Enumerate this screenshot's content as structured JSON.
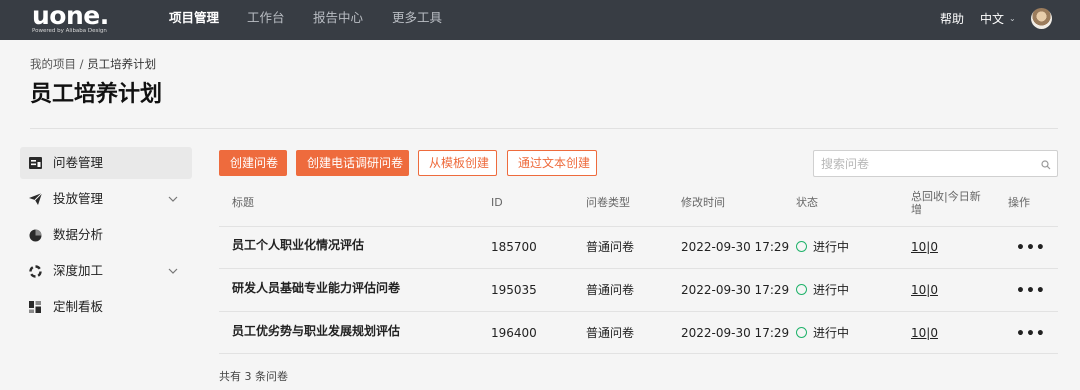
{
  "topbar": {
    "logo_text": "uone.",
    "logo_sub": "Powered by Alibaba Design",
    "nav": [
      "项目管理",
      "工作台",
      "报告中心",
      "更多工具"
    ],
    "help": "帮助",
    "language": "中文"
  },
  "breadcrumb": {
    "root": "我的项目",
    "separator": " / ",
    "current": "员工培养计划"
  },
  "page_title": "员工培养计划",
  "sidebar": {
    "items": [
      {
        "label": "问卷管理",
        "icon": "survey-icon",
        "active": true,
        "has_chevron": false
      },
      {
        "label": "投放管理",
        "icon": "send-icon",
        "active": false,
        "has_chevron": true
      },
      {
        "label": "数据分析",
        "icon": "pie-chart-icon",
        "active": false,
        "has_chevron": false
      },
      {
        "label": "深度加工",
        "icon": "process-icon",
        "active": false,
        "has_chevron": true
      },
      {
        "label": "定制看板",
        "icon": "dashboard-icon",
        "active": false,
        "has_chevron": false
      }
    ]
  },
  "actions": {
    "create": "创建问卷",
    "create_phone": "创建电话调研问卷",
    "from_template": "从模板创建",
    "from_text": "通过文本创建"
  },
  "search": {
    "placeholder": "搜索问卷"
  },
  "table": {
    "headers": [
      "标题",
      "ID",
      "问卷类型",
      "修改时间",
      "状态",
      "总回收|今日新增",
      "操作"
    ],
    "rows": [
      {
        "title": "员工个人职业化情况评估",
        "id": "185700",
        "type": "普通问卷",
        "modified": "2022-09-30 17:29",
        "status": "进行中",
        "counts": "10|0"
      },
      {
        "title": "研发人员基础专业能力评估问卷",
        "id": "195035",
        "type": "普通问卷",
        "modified": "2022-09-30 17:29",
        "status": "进行中",
        "counts": "10|0"
      },
      {
        "title": "员工优劣势与职业发展规划评估",
        "id": "196400",
        "type": "普通问卷",
        "modified": "2022-09-30 17:29",
        "status": "进行中",
        "counts": "10|0"
      }
    ],
    "more_glyph": "•••"
  },
  "footer": "共有 3 条问卷",
  "colors": {
    "accent": "#ee6b3d",
    "topbar": "#383d44",
    "status_active": "#21b36b"
  }
}
